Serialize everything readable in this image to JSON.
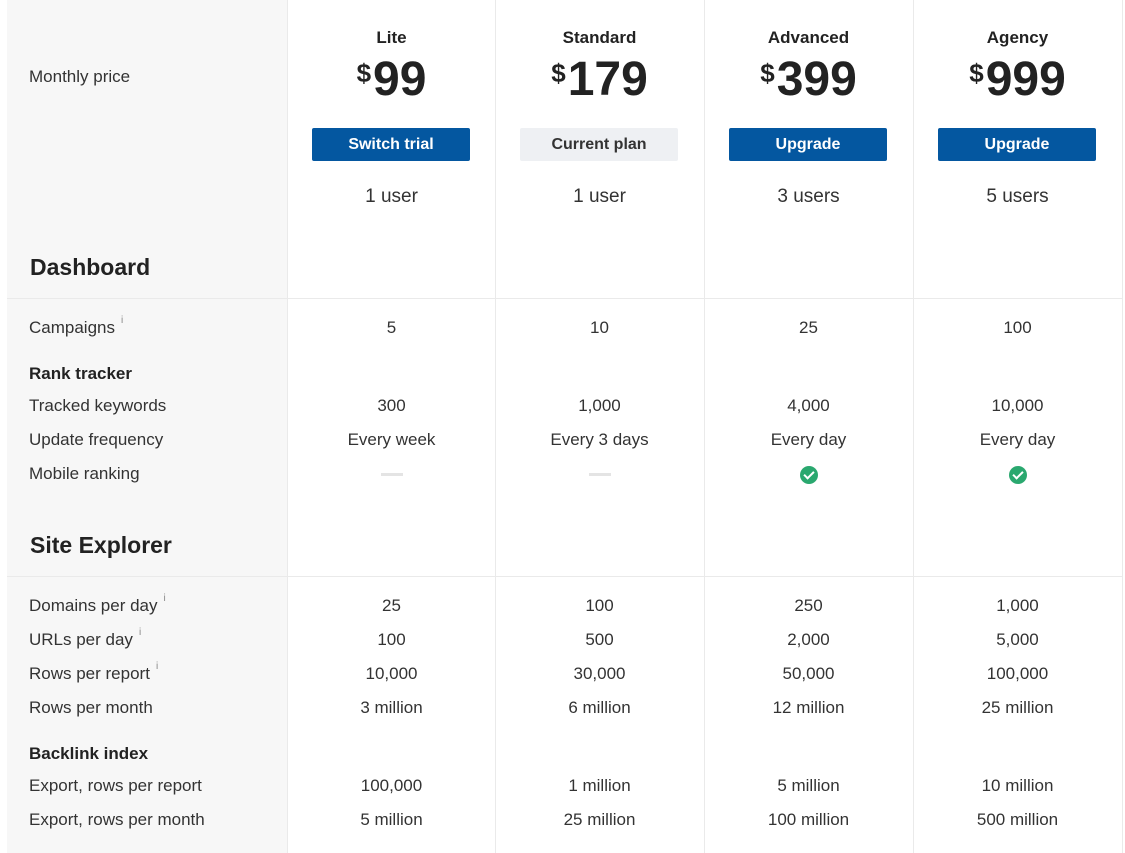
{
  "header": {
    "monthly_price_label": "Monthly price",
    "currency": "$"
  },
  "plans": [
    {
      "name": "Lite",
      "price": "99",
      "button": "Switch trial",
      "button_style": "primary",
      "users": "1 user"
    },
    {
      "name": "Standard",
      "price": "179",
      "button": "Current plan",
      "button_style": "current",
      "users": "1 user"
    },
    {
      "name": "Advanced",
      "price": "399",
      "button": "Upgrade",
      "button_style": "primary",
      "users": "3 users"
    },
    {
      "name": "Agency",
      "price": "999",
      "button": "Upgrade",
      "button_style": "primary",
      "users": "5 users"
    }
  ],
  "dashboard": {
    "title": "Dashboard",
    "campaigns": {
      "label": "Campaigns",
      "info": "i",
      "values": [
        "5",
        "10",
        "25",
        "100"
      ]
    },
    "rank_tracker": {
      "title": "Rank tracker",
      "tracked_keywords": {
        "label": "Tracked keywords",
        "values": [
          "300",
          "1,000",
          "4,000",
          "10,000"
        ]
      },
      "update_frequency": {
        "label": "Update frequency",
        "values": [
          "Every week",
          "Every 3 days",
          "Every day",
          "Every day"
        ]
      },
      "mobile_ranking": {
        "label": "Mobile ranking",
        "values": [
          "none",
          "none",
          "check",
          "check"
        ]
      }
    }
  },
  "site_explorer": {
    "title": "Site Explorer",
    "domains_per_day": {
      "label": "Domains per day",
      "info": "i",
      "values": [
        "25",
        "100",
        "250",
        "1,000"
      ]
    },
    "urls_per_day": {
      "label": "URLs per day",
      "info": "i",
      "values": [
        "100",
        "500",
        "2,000",
        "5,000"
      ]
    },
    "rows_per_report": {
      "label": "Rows per report",
      "info": "i",
      "values": [
        "10,000",
        "30,000",
        "50,000",
        "100,000"
      ]
    },
    "rows_per_month": {
      "label": "Rows per month",
      "values": [
        "3 million",
        "6 million",
        "12 million",
        "25 million"
      ]
    },
    "backlink_index": {
      "title": "Backlink index",
      "export_rows_per_report": {
        "label": "Export, rows per report",
        "values": [
          "100,000",
          "1 million",
          "5 million",
          "10 million"
        ]
      },
      "export_rows_per_month": {
        "label": "Export, rows per month",
        "values": [
          "5 million",
          "25 million",
          "100 million",
          "500 million"
        ]
      }
    }
  },
  "colors": {
    "primary_button": "#0457a0",
    "check_green": "#2aa86f",
    "label_column_bg": "#f7f7f7"
  }
}
